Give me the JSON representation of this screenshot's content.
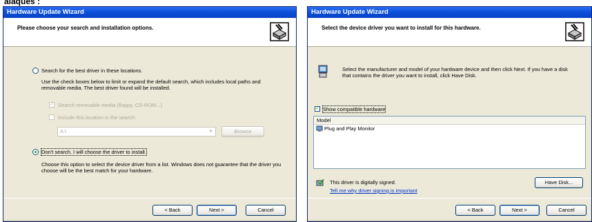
{
  "caption": "alaqués :",
  "window1": {
    "title": "Hardware Update Wizard",
    "header": "Please choose your search and installation options.",
    "opt_search": "Search for the best driver in these locations.",
    "search_desc": "Use the check boxes below to limit or expand the default search, which includes local paths and removable media. The best driver found will be installed.",
    "chk_removable": "Search removable media (floppy, CD-ROM...)",
    "chk_location": "Include this location in the search:",
    "path_value": "A:\\",
    "browse": "Browse",
    "opt_dont": "Don't search. I will choose the driver to install.",
    "dont_desc": "Choose this option to select the device driver from a list. Windows does not guarantee that the driver you choose will be the best match for your hardware.",
    "back": "< Back",
    "next": "Next >",
    "cancel": "Cancel"
  },
  "window2": {
    "title": "Hardware Update Wizard",
    "header": "Select the device driver you want to install for this hardware.",
    "intro": "Select the manufacturer and model of your hardware device and then click Next. If you have a disk that contains the driver you want to install, click Have Disk.",
    "chk_compatible": "Show compatible hardware",
    "list_header": "Model",
    "list_items": [
      "Plug and Play Monitor"
    ],
    "signed_text": "This driver is digitally signed.",
    "signing_link": "Tell me why driver signing is important",
    "have_disk": "Have Disk...",
    "back": "< Back",
    "next": "Next >",
    "cancel": "Cancel"
  }
}
